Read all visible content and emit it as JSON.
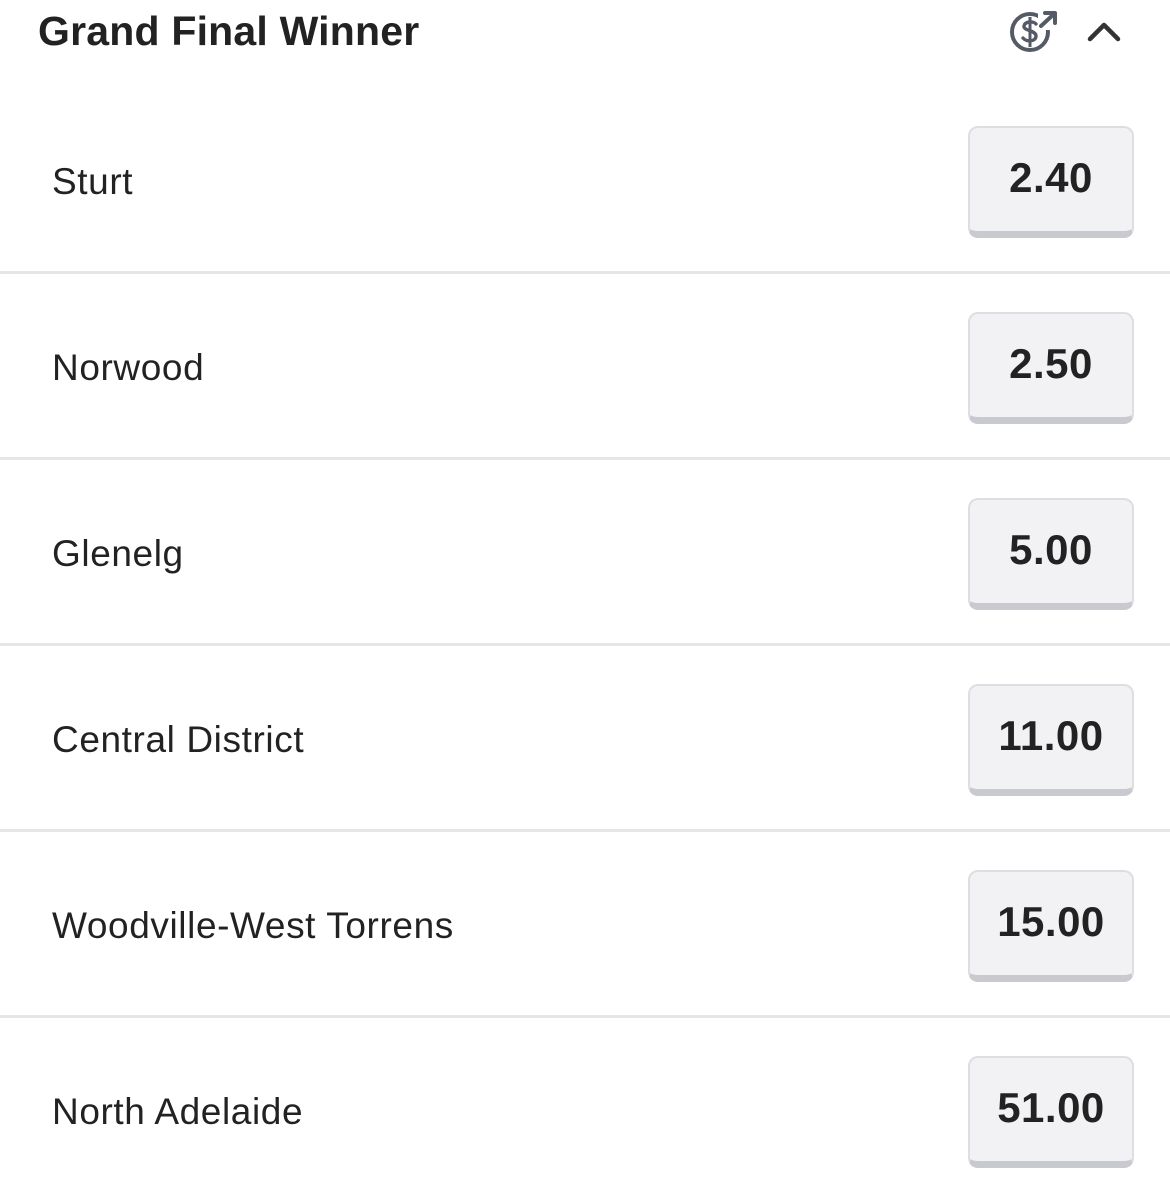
{
  "market": {
    "title": "Grand Final Winner",
    "icons": {
      "cashout": "cash-out-icon",
      "collapse": "chevron-up-icon"
    }
  },
  "runners": [
    {
      "name": "Sturt",
      "odds": "2.40"
    },
    {
      "name": "Norwood",
      "odds": "2.50"
    },
    {
      "name": "Glenelg",
      "odds": "5.00"
    },
    {
      "name": "Central District",
      "odds": "11.00"
    },
    {
      "name": "Woodville-West Torrens",
      "odds": "15.00"
    },
    {
      "name": "North Adelaide",
      "odds": "51.00"
    }
  ],
  "colors": {
    "text": "#222222",
    "icon": "#555b66",
    "odds_button_bg": "#f2f2f4",
    "divider": "#e6e6e8"
  }
}
